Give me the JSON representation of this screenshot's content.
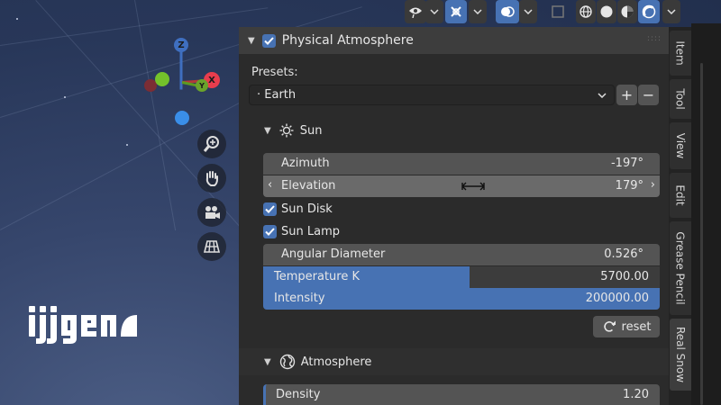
{
  "header_toolbar": {
    "buttons": [
      {
        "name": "visibility-icon"
      },
      {
        "name": "gizmo-icon"
      },
      {
        "name": "overlay-icon"
      },
      {
        "name": "xray-icon"
      },
      {
        "name": "wireframe-shading-icon"
      },
      {
        "name": "solid-shading-icon"
      },
      {
        "name": "material-shading-icon"
      },
      {
        "name": "rendered-shading-icon"
      }
    ]
  },
  "viewport": {
    "gizmo": {
      "z_label": "Z",
      "x_label": "X",
      "y_label": "Y"
    },
    "nav_icons": [
      "zoom-icon",
      "hand-pan-icon",
      "camera-icon",
      "grid-ortho-icon"
    ],
    "logo_text": "ijjigen"
  },
  "panel": {
    "title": "Physical Atmosphere",
    "enabled": true,
    "presets_label": "Presets:",
    "preset_value": "· Earth",
    "add_label": "+",
    "remove_label": "−",
    "sun": {
      "title": "Sun",
      "azimuth_label": "Azimuth",
      "azimuth_value": "-197°",
      "elevation_label": "Elevation",
      "elevation_value": "179°",
      "sun_disk_label": "Sun Disk",
      "sun_disk_checked": true,
      "sun_lamp_label": "Sun Lamp",
      "sun_lamp_checked": true,
      "angular_diameter_label": "Angular Diameter",
      "angular_diameter_value": "0.526°",
      "temperature_label": "Temperature K",
      "temperature_value": "5700.00",
      "temperature_fill": 0.52,
      "intensity_label": "Intensity",
      "intensity_value": "200000.00",
      "intensity_fill": 1.0,
      "reset_label": "reset"
    },
    "atmosphere": {
      "title": "Atmosphere",
      "density_label": "Density",
      "density_value": "1.20"
    }
  },
  "tabs": [
    "Item",
    "Tool",
    "View",
    "Edit",
    "Grease Pencil",
    "Real Snow"
  ],
  "colors": {
    "accent": "#4772b3",
    "panel_bg": "#2b2b2b",
    "field_bg": "#545454"
  }
}
